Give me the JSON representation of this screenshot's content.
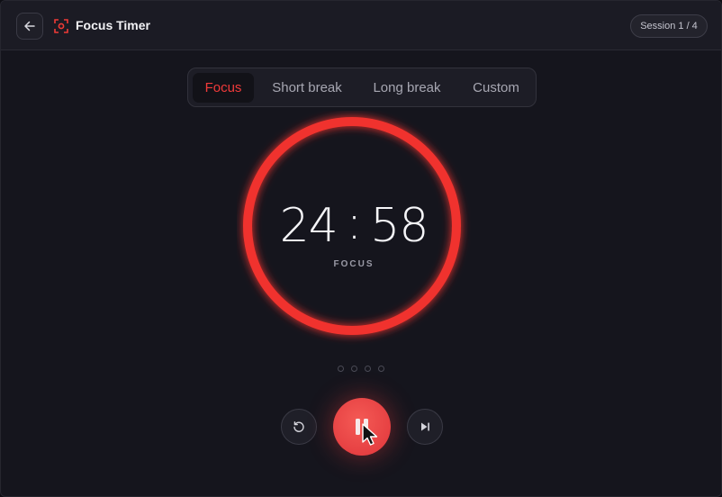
{
  "header": {
    "back_icon": "arrow-left-icon",
    "app_icon": "focus-target-icon",
    "title": "Focus Timer",
    "session_badge": "Session 1 / 4"
  },
  "modes": {
    "tabs": [
      {
        "label": "Focus",
        "active": true
      },
      {
        "label": "Short break",
        "active": false
      },
      {
        "label": "Long break",
        "active": false
      },
      {
        "label": "Custom",
        "active": false
      }
    ]
  },
  "timer": {
    "minutes": "24",
    "seconds": "58",
    "mode_label": "FOCUS",
    "ring_color": "#f0332f",
    "progress_fraction": 1.0
  },
  "sessions": {
    "total": 4,
    "completed": 0
  },
  "controls": {
    "reset_icon": "reset-icon",
    "pause_icon": "pause-icon",
    "skip_icon": "skip-next-icon"
  },
  "colors": {
    "accent": "#f0332f",
    "background": "#15151d",
    "header": "#1b1b24"
  }
}
